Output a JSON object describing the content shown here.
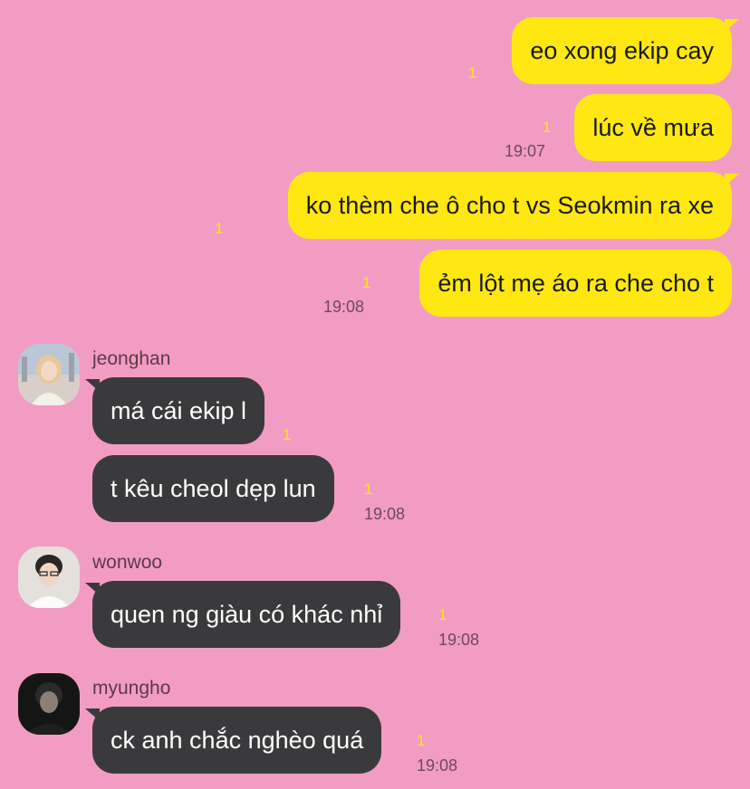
{
  "colors": {
    "background": "#f39cc3",
    "outgoing_bubble": "#ffe812",
    "incoming_bubble": "#3a3a3c",
    "unread_count": "#ffe812"
  },
  "outgoing": [
    {
      "text": "eo xong ekip cay",
      "unread": "1",
      "time": ""
    },
    {
      "text": "lúc về mưa",
      "unread": "1",
      "time": "19:07"
    },
    {
      "text": "ko thèm che ô cho t vs Seokmin ra xe",
      "unread": "1",
      "time": ""
    },
    {
      "text": "ẻm lột mẹ áo ra che cho t",
      "unread": "1",
      "time": "19:08"
    }
  ],
  "groups": [
    {
      "sender": "jeonghan",
      "avatar_icon": "profile-photo-icon",
      "messages": [
        {
          "text": "má cái ekip l",
          "unread": "1",
          "time": ""
        },
        {
          "text": "t kêu cheol dẹp lun",
          "unread": "1",
          "time": "19:08"
        }
      ]
    },
    {
      "sender": "wonwoo",
      "avatar_icon": "profile-photo-icon",
      "messages": [
        {
          "text": "quen ng giàu có khác nhỉ",
          "unread": "1",
          "time": "19:08"
        }
      ]
    },
    {
      "sender": "myungho",
      "avatar_icon": "profile-photo-icon",
      "messages": [
        {
          "text": "ck anh chắc nghèo quá",
          "unread": "1",
          "time": "19:08"
        }
      ]
    }
  ]
}
